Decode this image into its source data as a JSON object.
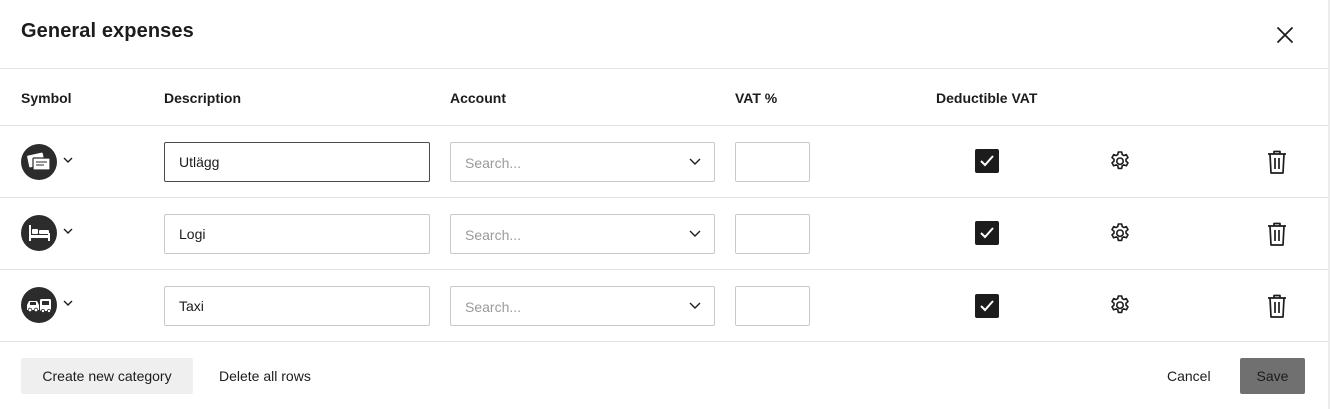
{
  "dialog": {
    "title": "General expenses",
    "close_icon": "close-icon"
  },
  "columns": {
    "symbol": "Symbol",
    "description": "Description",
    "account": "Account",
    "vat": "VAT %",
    "deductible_vat": "Deductible VAT"
  },
  "rows": [
    {
      "symbol_icon": "receipt-icon",
      "description": "Utlägg",
      "account_placeholder": "Search...",
      "vat": "",
      "deductible_vat": true,
      "focused": true
    },
    {
      "symbol_icon": "bed-icon",
      "description": "Logi",
      "account_placeholder": "Search...",
      "vat": "",
      "deductible_vat": true
    },
    {
      "symbol_icon": "taxi-icon",
      "description": "Taxi",
      "account_placeholder": "Search...",
      "vat": "",
      "deductible_vat": true
    }
  ],
  "footer": {
    "create_new_category": "Create new category",
    "delete_all_rows": "Delete all rows",
    "cancel": "Cancel",
    "save": "Save"
  },
  "colors": {
    "primary_button": "#707070",
    "secondary_button": "#efefef",
    "checkbox": "#1c1c1c",
    "border": "#c9c9c9"
  }
}
